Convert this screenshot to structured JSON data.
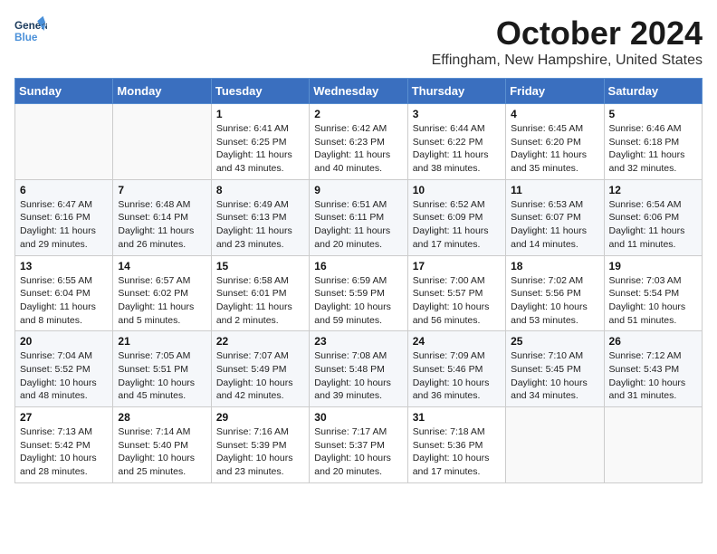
{
  "header": {
    "logo_general": "General",
    "logo_blue": "Blue",
    "month_title": "October 2024",
    "location": "Effingham, New Hampshire, United States"
  },
  "weekdays": [
    "Sunday",
    "Monday",
    "Tuesday",
    "Wednesday",
    "Thursday",
    "Friday",
    "Saturday"
  ],
  "weeks": [
    [
      {
        "day": "",
        "info": ""
      },
      {
        "day": "",
        "info": ""
      },
      {
        "day": "1",
        "info": "Sunrise: 6:41 AM\nSunset: 6:25 PM\nDaylight: 11 hours and 43 minutes."
      },
      {
        "day": "2",
        "info": "Sunrise: 6:42 AM\nSunset: 6:23 PM\nDaylight: 11 hours and 40 minutes."
      },
      {
        "day": "3",
        "info": "Sunrise: 6:44 AM\nSunset: 6:22 PM\nDaylight: 11 hours and 38 minutes."
      },
      {
        "day": "4",
        "info": "Sunrise: 6:45 AM\nSunset: 6:20 PM\nDaylight: 11 hours and 35 minutes."
      },
      {
        "day": "5",
        "info": "Sunrise: 6:46 AM\nSunset: 6:18 PM\nDaylight: 11 hours and 32 minutes."
      }
    ],
    [
      {
        "day": "6",
        "info": "Sunrise: 6:47 AM\nSunset: 6:16 PM\nDaylight: 11 hours and 29 minutes."
      },
      {
        "day": "7",
        "info": "Sunrise: 6:48 AM\nSunset: 6:14 PM\nDaylight: 11 hours and 26 minutes."
      },
      {
        "day": "8",
        "info": "Sunrise: 6:49 AM\nSunset: 6:13 PM\nDaylight: 11 hours and 23 minutes."
      },
      {
        "day": "9",
        "info": "Sunrise: 6:51 AM\nSunset: 6:11 PM\nDaylight: 11 hours and 20 minutes."
      },
      {
        "day": "10",
        "info": "Sunrise: 6:52 AM\nSunset: 6:09 PM\nDaylight: 11 hours and 17 minutes."
      },
      {
        "day": "11",
        "info": "Sunrise: 6:53 AM\nSunset: 6:07 PM\nDaylight: 11 hours and 14 minutes."
      },
      {
        "day": "12",
        "info": "Sunrise: 6:54 AM\nSunset: 6:06 PM\nDaylight: 11 hours and 11 minutes."
      }
    ],
    [
      {
        "day": "13",
        "info": "Sunrise: 6:55 AM\nSunset: 6:04 PM\nDaylight: 11 hours and 8 minutes."
      },
      {
        "day": "14",
        "info": "Sunrise: 6:57 AM\nSunset: 6:02 PM\nDaylight: 11 hours and 5 minutes."
      },
      {
        "day": "15",
        "info": "Sunrise: 6:58 AM\nSunset: 6:01 PM\nDaylight: 11 hours and 2 minutes."
      },
      {
        "day": "16",
        "info": "Sunrise: 6:59 AM\nSunset: 5:59 PM\nDaylight: 10 hours and 59 minutes."
      },
      {
        "day": "17",
        "info": "Sunrise: 7:00 AM\nSunset: 5:57 PM\nDaylight: 10 hours and 56 minutes."
      },
      {
        "day": "18",
        "info": "Sunrise: 7:02 AM\nSunset: 5:56 PM\nDaylight: 10 hours and 53 minutes."
      },
      {
        "day": "19",
        "info": "Sunrise: 7:03 AM\nSunset: 5:54 PM\nDaylight: 10 hours and 51 minutes."
      }
    ],
    [
      {
        "day": "20",
        "info": "Sunrise: 7:04 AM\nSunset: 5:52 PM\nDaylight: 10 hours and 48 minutes."
      },
      {
        "day": "21",
        "info": "Sunrise: 7:05 AM\nSunset: 5:51 PM\nDaylight: 10 hours and 45 minutes."
      },
      {
        "day": "22",
        "info": "Sunrise: 7:07 AM\nSunset: 5:49 PM\nDaylight: 10 hours and 42 minutes."
      },
      {
        "day": "23",
        "info": "Sunrise: 7:08 AM\nSunset: 5:48 PM\nDaylight: 10 hours and 39 minutes."
      },
      {
        "day": "24",
        "info": "Sunrise: 7:09 AM\nSunset: 5:46 PM\nDaylight: 10 hours and 36 minutes."
      },
      {
        "day": "25",
        "info": "Sunrise: 7:10 AM\nSunset: 5:45 PM\nDaylight: 10 hours and 34 minutes."
      },
      {
        "day": "26",
        "info": "Sunrise: 7:12 AM\nSunset: 5:43 PM\nDaylight: 10 hours and 31 minutes."
      }
    ],
    [
      {
        "day": "27",
        "info": "Sunrise: 7:13 AM\nSunset: 5:42 PM\nDaylight: 10 hours and 28 minutes."
      },
      {
        "day": "28",
        "info": "Sunrise: 7:14 AM\nSunset: 5:40 PM\nDaylight: 10 hours and 25 minutes."
      },
      {
        "day": "29",
        "info": "Sunrise: 7:16 AM\nSunset: 5:39 PM\nDaylight: 10 hours and 23 minutes."
      },
      {
        "day": "30",
        "info": "Sunrise: 7:17 AM\nSunset: 5:37 PM\nDaylight: 10 hours and 20 minutes."
      },
      {
        "day": "31",
        "info": "Sunrise: 7:18 AM\nSunset: 5:36 PM\nDaylight: 10 hours and 17 minutes."
      },
      {
        "day": "",
        "info": ""
      },
      {
        "day": "",
        "info": ""
      }
    ]
  ]
}
